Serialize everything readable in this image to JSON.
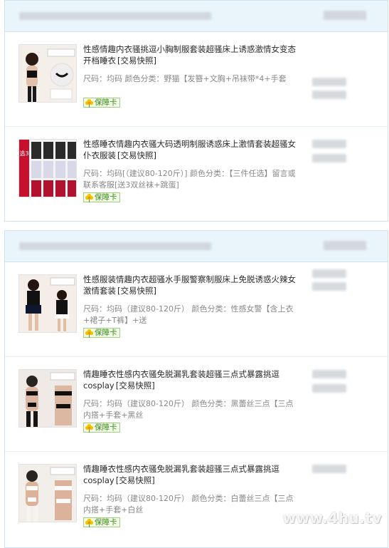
{
  "groups": [
    {
      "items": [
        {
          "title": "性感情趣内衣骚挑逗小胸制服套装超骚床上诱惑激情女变态开档睡衣",
          "snapshot": "[交易快照]",
          "sku": "尺码：均码   颜色分类：野猫【发簪+文胸+吊袜带*4+手套",
          "badge": "保障卡",
          "thumb": {
            "banner": "",
            "colors": [
              "#1a1a1a",
              "#e8c9b6",
              "#333"
            ]
          }
        },
        {
          "title": "性感睡衣情趣内衣骚大码透明制服诱惑床上激情套装超骚女仆衣服装",
          "snapshot": "[交易快照]",
          "sku": "尺码：均码[（建议80-120斤）]   颜色分类：【三件任选】留言或联系客服[送3双丝袜+跳蛋]",
          "badge": "保障卡",
          "thumb": {
            "banner": "自选3款",
            "colors": [
              "#c8102e",
              "#f2f2f2",
              "#222"
            ]
          }
        }
      ]
    },
    {
      "items": [
        {
          "title": "性感服装情趣内衣超骚水手服警察制服床上免脱诱惑火辣女激情套装",
          "snapshot": "[交易快照]",
          "sku": "尺码：均码（建议80-120斤）   颜色分类：性感女警【含上衣+裙子+T裤】+送",
          "badge": "保障卡",
          "thumb": {
            "banner": "",
            "colors": [
              "#111",
              "#e6c3ad",
              "#fff"
            ]
          }
        },
        {
          "title": "情趣睡衣性感内衣骚免脱漏乳套装超骚三点式暴露挑逗cosplay",
          "snapshot": "[交易快照]",
          "sku": "尺码：均码（建议80-120斤）   颜色分类：黑蕾丝三点【三点内搭+手套+黑丝",
          "badge": "保障卡",
          "thumb": {
            "banner": "",
            "colors": [
              "#151515",
              "#dcb8a2",
              "#444"
            ]
          }
        },
        {
          "title": "情趣睡衣性感内衣骚免脱漏乳套装超骚三点式暴露挑逗cosplay",
          "snapshot": "[交易快照]",
          "sku": "尺码：均码（建议80-120斤）   颜色分类：白蕾丝三点【三点内搭+手套+白丝",
          "badge": "保障卡",
          "thumb": {
            "banner": "",
            "colors": [
              "#f7f4f0",
              "#d9b39a",
              "#2b2b2b"
            ]
          }
        }
      ]
    }
  ],
  "watermark": "www.4hu.tv",
  "colors": {
    "header_bg": "#eaf4fb",
    "border": "#cfe4f3",
    "badge_text": "#3a8a1a"
  }
}
